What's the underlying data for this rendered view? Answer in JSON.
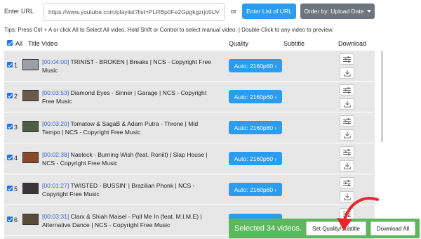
{
  "header": {
    "url_label": "Enter URL",
    "url_value": "https://www.youtube.com/playlist?list=PLRBp0Fe2Gpgkgzrjo5lJvV",
    "or_label": "or",
    "enter_list_label": "Enter List of URL",
    "order_label": "Order by: Upload Date"
  },
  "tips": "Tips: Press Ctrl + A or click All to Select All video. Hold Shift or Control to select manual video. | Double-Click to any video to preview.",
  "table": {
    "all_label": "All",
    "title_header": "Title Video",
    "quality_header": "Quality",
    "subtitle_header": "Subtitle",
    "download_header": "Download"
  },
  "rows": [
    {
      "index": "1",
      "duration": "[00:04:00]",
      "title": " TRINIST - BROKEN | Breaks | NCS - Copyright Free Music",
      "quality": "Auto: 2160p60 ›",
      "thumb_color": "#9aa0a8"
    },
    {
      "index": "2",
      "duration": "[00:03:53]",
      "title": " Diamond Eyes - Sinner | Garage | NCS - Copyright Free Music",
      "quality": "Auto: 2160p60 ›",
      "thumb_color": "#6b5a48"
    },
    {
      "index": "3",
      "duration": "[00:03:20]",
      "title": " Tomatow & SagaB & Adam Putra - Throne | Mid Tempo | NCS - Copyright Free Music",
      "quality": "Auto: 2160p60 ›",
      "thumb_color": "#4c5f46"
    },
    {
      "index": "4",
      "duration": "[00:02:38]",
      "title": " Naeleck - Burning Wish (feat. Roniit) | Slap House | NCS - Copyright Free Music",
      "quality": "Auto: 2160p60 ›",
      "thumb_color": "#8a4a2a"
    },
    {
      "index": "5",
      "duration": "[00:01:27]",
      "title": " TWISTED - BUSSIN' | Brazilian Phonk | NCS - Copyright Free Music",
      "quality": "Auto: 2160p60 ›",
      "thumb_color": "#3a3438"
    },
    {
      "index": "6",
      "duration": "[00:03:31]",
      "title": " Clarx & Shiah Maisel - Pull Me In (feat. M.I.M.E) | Alternative Dance | NCS - Copyright Free Music",
      "quality": "Auto: 2160p60 ›",
      "thumb_color": "#5a4a3a"
    }
  ],
  "footer": {
    "selected_text": "Selected 34 videos.",
    "set_quality_label": "Set Quality/Subtitle",
    "download_all_label": "Download All"
  },
  "colors": {
    "primary_blue": "#2b9cf0",
    "order_gray": "#6c757d",
    "action_green": "#5cb85c",
    "duration_blue": "#3a66c8",
    "arrow_red": "#e8262a"
  },
  "icons": {
    "settings": "sliders-icon",
    "download": "download-icon",
    "order_caret": "chevron-down-icon"
  }
}
